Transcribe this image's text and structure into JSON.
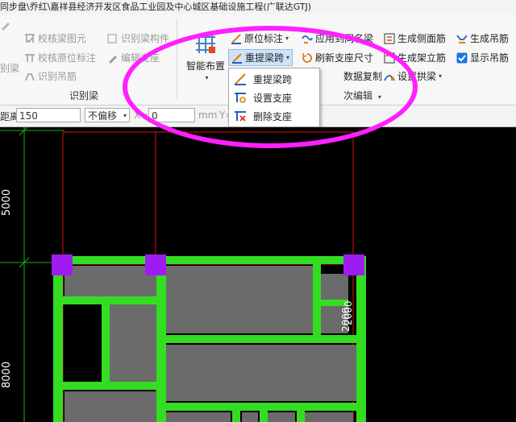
{
  "title_bar": {
    "text": "同步盘\\乔红\\嘉祥县经济开发区食品工业园及中心城区基础设施工程(广联达GTJ)"
  },
  "ribbon": {
    "left_group": {
      "label": "识别梁",
      "items": [
        "校核梁图元",
        "识别吊筋",
        "校核原位标注",
        "编辑支座",
        "识别吊筋"
      ],
      "partial_items": [
        "识别梁构件",
        "别梁"
      ]
    },
    "smart_layout": {
      "label": "智能布置"
    },
    "beam_group": {
      "items": {
        "in_situ_label": "原位标注",
        "re_extract_span": "重提梁跨",
        "apply_same_name": "应用到同名梁",
        "refresh_support_size": "刷新支座尺寸",
        "data_copy": "数据复制",
        "set_arch_beam": "设置拱梁"
      },
      "edit_label": "次编辑"
    },
    "gen_group": {
      "items": {
        "gen_side_rebar": "生成侧面筋",
        "gen_hanging_rebar": "生成吊筋",
        "gen_stand_rebar": "生成架立筋",
        "show_hanging_rebar": "显示吊筋"
      }
    }
  },
  "dropdown": {
    "items": [
      "重提梁跨",
      "设置支座",
      "删除支座"
    ]
  },
  "toolbar": {
    "distance_label": "距离:",
    "distance_value": "150",
    "offset_select": "不偏移",
    "x_label": "X=",
    "x_value": "0",
    "unit_mm": "mm",
    "y_label": "Y="
  },
  "canvas": {
    "dims": [
      "5000",
      "8000",
      "2000",
      "2000"
    ]
  },
  "colors": {
    "beam_green": "#33dd22",
    "column_purple": "#9e1cf2",
    "slab_gray": "#6b6b6b",
    "annotation_magenta": "#ff1fff",
    "grid_red": "#e01010"
  }
}
